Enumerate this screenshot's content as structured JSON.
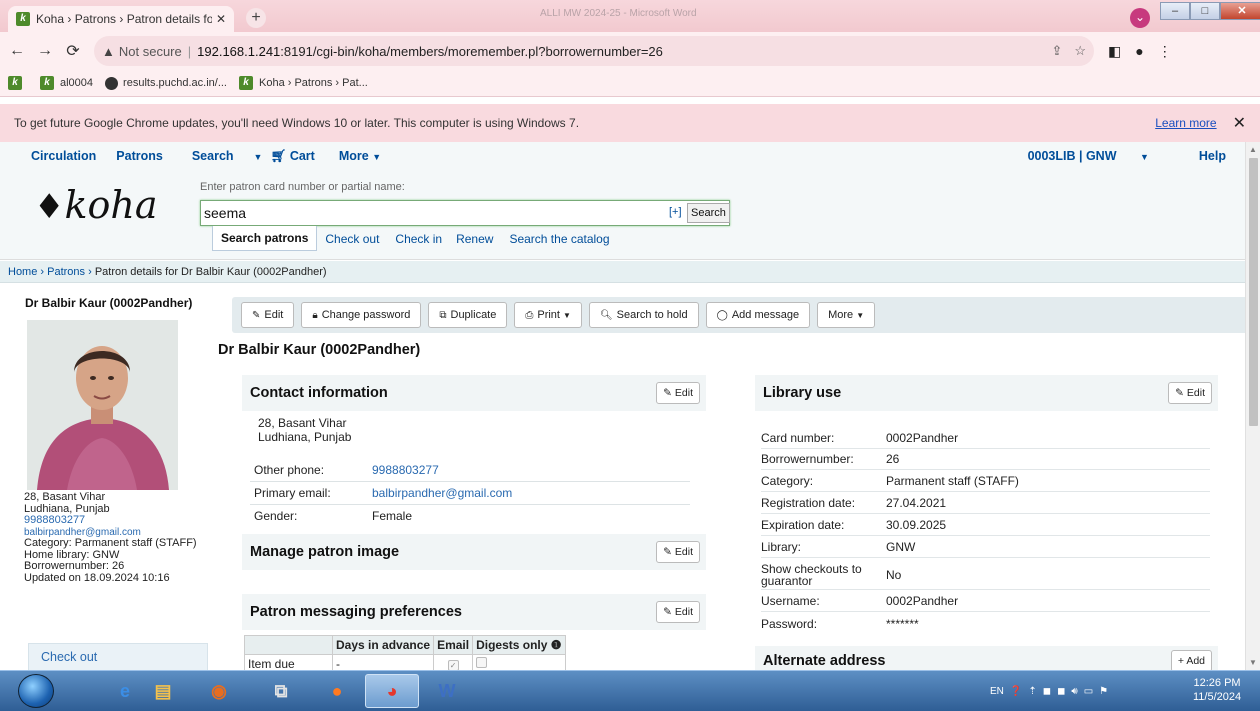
{
  "browser": {
    "tab_title": "Koha › Patrons › Patron details fo",
    "window_title": "ALLI MW 2024-25 - Microsoft Word",
    "url_host": "192.168.1.241",
    "url_rest": ":8191/cgi-bin/koha/members/moremember.pl?borrowernumber=26",
    "not_secure": "Not secure",
    "bookmarks": [
      "al0004",
      "results.puchd.ac.in/...",
      "Koha › Patrons › Pat..."
    ],
    "infobar_text": "To get future Google Chrome updates, you'll need Windows 10 or later. This computer is using Windows 7.",
    "infobar_link": "Learn more"
  },
  "topnav": {
    "circulation": "Circulation",
    "patrons": "Patrons",
    "search": "Search",
    "cart": "Cart",
    "more": "More",
    "library": "0003LIB | GNW",
    "help": "Help"
  },
  "search": {
    "logo": "koha",
    "label": "Enter patron card number or partial name:",
    "value": "seema",
    "plus": "[+]",
    "button": "Search",
    "tabs": [
      "Search patrons",
      "Check out",
      "Check in",
      "Renew",
      "Search the catalog"
    ]
  },
  "breadcrumb": {
    "home": "Home",
    "patrons": "Patrons",
    "current": "Patron details for Dr Balbir Kaur (0002Pandher)"
  },
  "sidebar": {
    "name": "Dr Balbir Kaur (0002Pandher)",
    "address1": "28, Basant Vihar",
    "address2": "Ludhiana, Punjab",
    "phone": "9988803277",
    "email": "balbirpandher@gmail.com",
    "category": "Category: Parmanent staff (STAFF)",
    "home_library": "Home library: GNW",
    "borrowernumber": "Borrowernumber: 26",
    "updated": "Updated on 18.09.2024 10:16",
    "checkout": "Check out"
  },
  "toolbar": {
    "edit": "Edit",
    "change_password": "Change password",
    "duplicate": "Duplicate",
    "print": "Print",
    "search_to_hold": "Search to hold",
    "add_message": "Add message",
    "more": "More"
  },
  "patron_title": "Dr Balbir Kaur (0002Pandher)",
  "contact": {
    "heading": "Contact information",
    "edit": "Edit",
    "address1": "28, Basant Vihar",
    "address2": "Ludhiana, Punjab",
    "rows": [
      {
        "label": "Other phone:",
        "value": "9988803277"
      },
      {
        "label": "Primary email:",
        "value": "balbirpandher@gmail.com"
      },
      {
        "label": "Gender:",
        "value": "Female"
      }
    ]
  },
  "manage_image": {
    "heading": "Manage patron image",
    "edit": "Edit"
  },
  "messaging": {
    "heading": "Patron messaging preferences",
    "edit": "Edit",
    "columns": [
      "",
      "Days in advance",
      "Email",
      "Digests only"
    ],
    "row_label": "Item due",
    "row_days": "-"
  },
  "library_use": {
    "heading": "Library use",
    "edit": "Edit",
    "rows": [
      {
        "label": "Card number:",
        "value": "0002Pandher"
      },
      {
        "label": "Borrowernumber:",
        "value": "26"
      },
      {
        "label": "Category:",
        "value": "Parmanent staff (STAFF)"
      },
      {
        "label": "Registration date:",
        "value": "27.04.2021"
      },
      {
        "label": "Expiration date:",
        "value": "30.09.2025"
      },
      {
        "label": "Library:",
        "value": "GNW"
      },
      {
        "label": "Show checkouts to guarantor",
        "value": "No"
      },
      {
        "label": "Username:",
        "value": "0002Pandher"
      },
      {
        "label": "Password:",
        "value": "*******"
      }
    ]
  },
  "alternate": {
    "heading": "Alternate address",
    "add": "Add"
  },
  "taskbar": {
    "lang": "EN",
    "time": "12:26 PM",
    "date": "11/5/2024"
  }
}
